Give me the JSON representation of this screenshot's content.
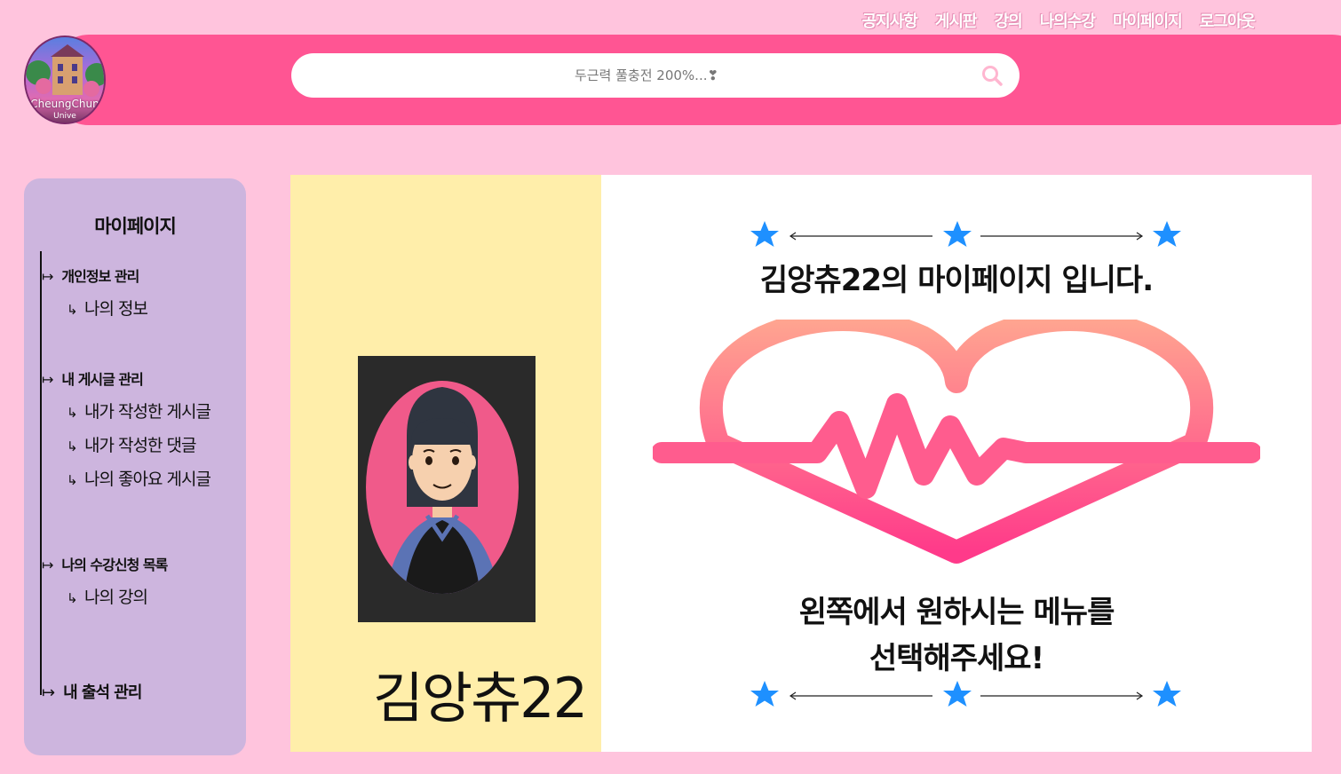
{
  "nav": {
    "items": [
      "공지사항",
      "게시판",
      "강의",
      "나의수강",
      "마이페이지",
      "로그아웃"
    ]
  },
  "logo": {
    "text": "CheungChun",
    "sub": "Unive"
  },
  "search": {
    "placeholder": "두근력 풀충전 200%...❣"
  },
  "sidebar": {
    "title": "마이페이지",
    "sections": [
      {
        "label": "개인정보 관리",
        "items": [
          "나의 정보"
        ]
      },
      {
        "label": "내 게시글 관리",
        "items": [
          "내가 작성한 게시글",
          "내가 작성한 댓글",
          "나의 좋아요 게시글"
        ]
      },
      {
        "label": "나의 수강신청 목록",
        "items": [
          "나의 강의"
        ]
      },
      {
        "label": "내 출석 관리",
        "items": []
      }
    ],
    "arrow": "↦",
    "hook": "↳"
  },
  "profile": {
    "username": "김앙츄22"
  },
  "main": {
    "welcome": "김앙츄22의 마이페이지 입니다.",
    "instruction_line1": "왼쪽에서 원하시는 메뉴를",
    "instruction_line2": "선택해주세요!"
  },
  "colors": {
    "background": "#ffc4dd",
    "header": "#ff5593",
    "sidebar": "#cdb5de",
    "profile_panel": "#ffeeaa",
    "star": "#1e90ff",
    "heart_top": "#ffa08a",
    "heart_bottom": "#ff3d8a"
  }
}
